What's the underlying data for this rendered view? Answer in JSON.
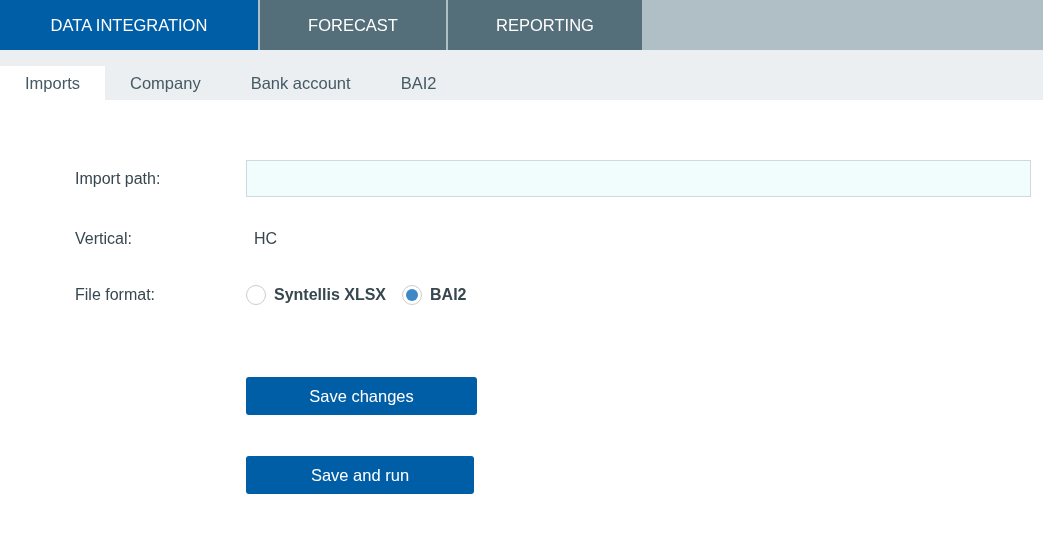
{
  "main_tabs": [
    {
      "label": "DATA INTEGRATION",
      "selected": true
    },
    {
      "label": "FORECAST",
      "selected": false
    },
    {
      "label": "REPORTING",
      "selected": false
    }
  ],
  "sub_tabs": [
    {
      "label": "Imports",
      "selected": true
    },
    {
      "label": "Company",
      "selected": false
    },
    {
      "label": "Bank account",
      "selected": false
    },
    {
      "label": "BAI2",
      "selected": false
    }
  ],
  "form": {
    "import_path": {
      "label": "Import path:"
    },
    "vertical": {
      "label": "Vertical:",
      "value": "HC"
    },
    "file_format": {
      "label": "File format:",
      "options": [
        {
          "label": "Syntellis XLSX",
          "selected": false
        },
        {
          "label": "BAI2",
          "selected": true
        }
      ]
    }
  },
  "buttons": [
    "Save changes",
    "Save and run"
  ]
}
